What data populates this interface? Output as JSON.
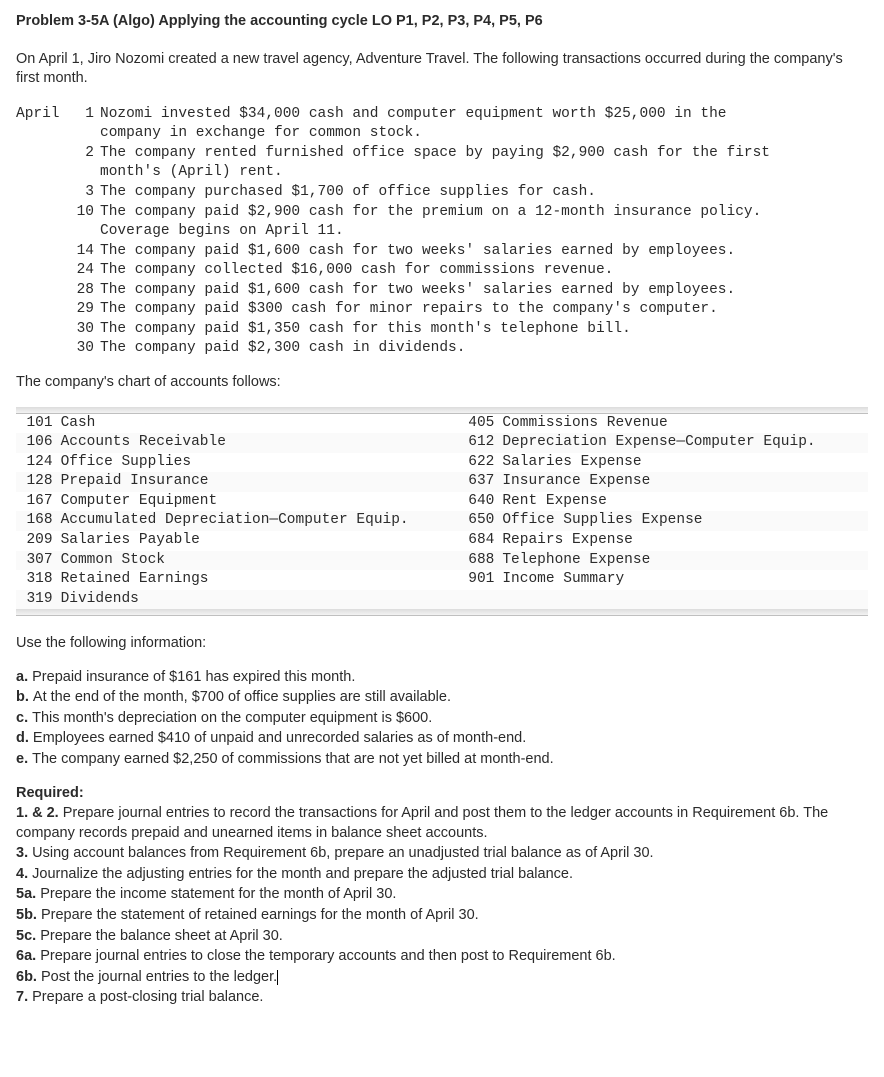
{
  "title": "Problem 3-5A (Algo) Applying the accounting cycle LO P1, P2, P3, P4, P5, P6",
  "intro": "On April 1, Jiro Nozomi created a new travel agency, Adventure Travel. The following transactions occurred during the company's first month.",
  "month_label": "April",
  "transactions": [
    {
      "day": "1",
      "text": "Nozomi invested $34,000 cash and computer equipment worth $25,000 in the company in exchange for common stock."
    },
    {
      "day": "2",
      "text": "The company rented furnished office space by paying $2,900 cash for the first month's (April) rent."
    },
    {
      "day": "3",
      "text": "The company purchased $1,700 of office supplies for cash."
    },
    {
      "day": "10",
      "text": "The company paid $2,900 cash for the premium on a 12-month insurance policy. Coverage begins on April 11."
    },
    {
      "day": "14",
      "text": "The company paid $1,600 cash for two weeks' salaries earned by employees."
    },
    {
      "day": "24",
      "text": "The company collected $16,000 cash for commissions revenue."
    },
    {
      "day": "28",
      "text": "The company paid $1,600 cash for two weeks' salaries earned by employees."
    },
    {
      "day": "29",
      "text": "The company paid $300 cash for minor repairs to the company's computer."
    },
    {
      "day": "30",
      "text": "The company paid $1,350 cash for this month's telephone bill."
    },
    {
      "day": "30",
      "text": "The company paid $2,300 cash in dividends."
    }
  ],
  "chart_intro": "The company's chart of accounts follows:",
  "chart_data": {
    "type": "table",
    "rows": [
      {
        "lnum": "101",
        "lname": "Cash",
        "rnum": "405",
        "rname": "Commissions Revenue"
      },
      {
        "lnum": "106",
        "lname": "Accounts Receivable",
        "rnum": "612",
        "rname": "Depreciation Expense—Computer Equip."
      },
      {
        "lnum": "124",
        "lname": "Office Supplies",
        "rnum": "622",
        "rname": "Salaries Expense"
      },
      {
        "lnum": "128",
        "lname": "Prepaid Insurance",
        "rnum": "637",
        "rname": "Insurance Expense"
      },
      {
        "lnum": "167",
        "lname": "Computer Equipment",
        "rnum": "640",
        "rname": "Rent Expense"
      },
      {
        "lnum": "168",
        "lname": "Accumulated Depreciation—Computer Equip.",
        "rnum": "650",
        "rname": "Office Supplies Expense"
      },
      {
        "lnum": "209",
        "lname": "Salaries Payable",
        "rnum": "684",
        "rname": "Repairs Expense"
      },
      {
        "lnum": "307",
        "lname": "Common Stock",
        "rnum": "688",
        "rname": "Telephone Expense"
      },
      {
        "lnum": "318",
        "lname": "Retained Earnings",
        "rnum": "901",
        "rname": "Income Summary"
      },
      {
        "lnum": "319",
        "lname": "Dividends",
        "rnum": "",
        "rname": ""
      }
    ]
  },
  "info_intro": "Use the following information:",
  "info_items": [
    {
      "label": "a.",
      "text": "Prepaid insurance of $161 has expired this month."
    },
    {
      "label": "b.",
      "text": "At the end of the month, $700 of office supplies are still available."
    },
    {
      "label": "c.",
      "text": "This month's depreciation on the computer equipment is $600."
    },
    {
      "label": "d.",
      "text": "Employees earned $410 of unpaid and unrecorded salaries as of month-end."
    },
    {
      "label": "e.",
      "text": "The company earned $2,250 of commissions that are not yet billed at month-end."
    }
  ],
  "req_head": "Required:",
  "req_items": [
    {
      "label": "1. & 2.",
      "text": "Prepare journal entries to record the transactions for April and post them to the ledger accounts in Requirement 6b. The company records prepaid and unearned items in balance sheet accounts."
    },
    {
      "label": "3.",
      "text": "Using account balances from Requirement 6b, prepare an unadjusted trial balance as of April 30."
    },
    {
      "label": "4.",
      "text": "Journalize the adjusting entries for the month and prepare the adjusted trial balance."
    },
    {
      "label": "5a.",
      "text": "Prepare the income statement for the month of April 30."
    },
    {
      "label": "5b.",
      "text": "Prepare the statement of retained earnings for the month of April 30."
    },
    {
      "label": "5c.",
      "text": "Prepare the balance sheet at April 30."
    },
    {
      "label": "6a.",
      "text": "Prepare journal entries to close the temporary accounts and then post to Requirement 6b."
    },
    {
      "label": "6b.",
      "text": "Post the journal entries to the ledger."
    },
    {
      "label": "7.",
      "text": "Prepare a post-closing trial balance."
    }
  ]
}
